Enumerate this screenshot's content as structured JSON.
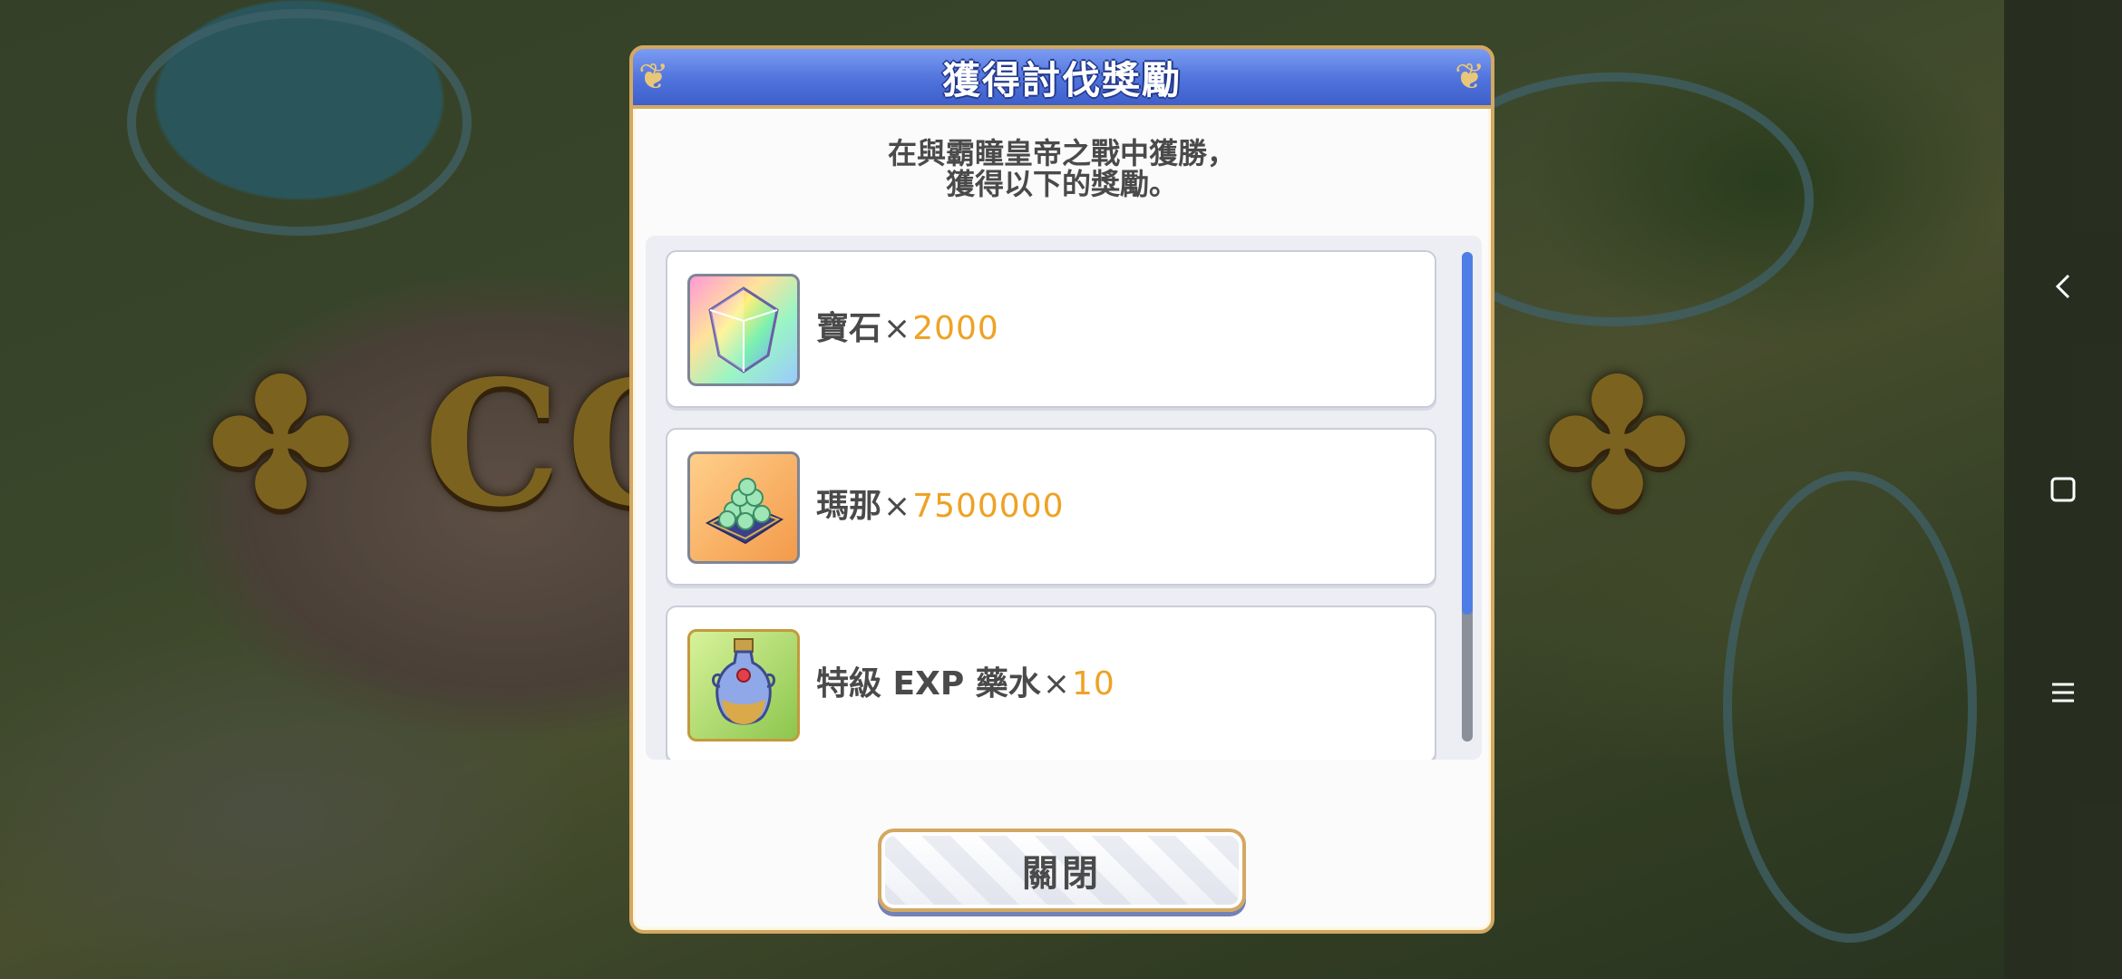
{
  "background": {
    "banner_text": "✤ CON          ONS! ✤"
  },
  "dialog": {
    "title": "獲得討伐獎勵",
    "message_line1": "在與霸瞳皇帝之戰中獲勝，",
    "message_line2": "獲得以下的獎勵。",
    "rewards": [
      {
        "name": "寶石",
        "times": "×",
        "quantity": "2000",
        "icon": "rainbow-gem-icon"
      },
      {
        "name": "瑪那",
        "times": "×",
        "quantity": "7500000",
        "icon": "mana-coins-icon"
      },
      {
        "name": "特級 EXP 藥水",
        "times": "×",
        "quantity": "10",
        "icon": "exp-potion-icon"
      }
    ],
    "close_label": "關閉"
  },
  "navbar": {
    "icons": [
      "back-icon",
      "home-square-icon",
      "menu-icon"
    ]
  },
  "colors": {
    "header_blue": "#4f72dc",
    "frame_gold": "#d3a862",
    "quantity_orange": "#eea224",
    "scroll_thumb": "#4f7de6"
  }
}
